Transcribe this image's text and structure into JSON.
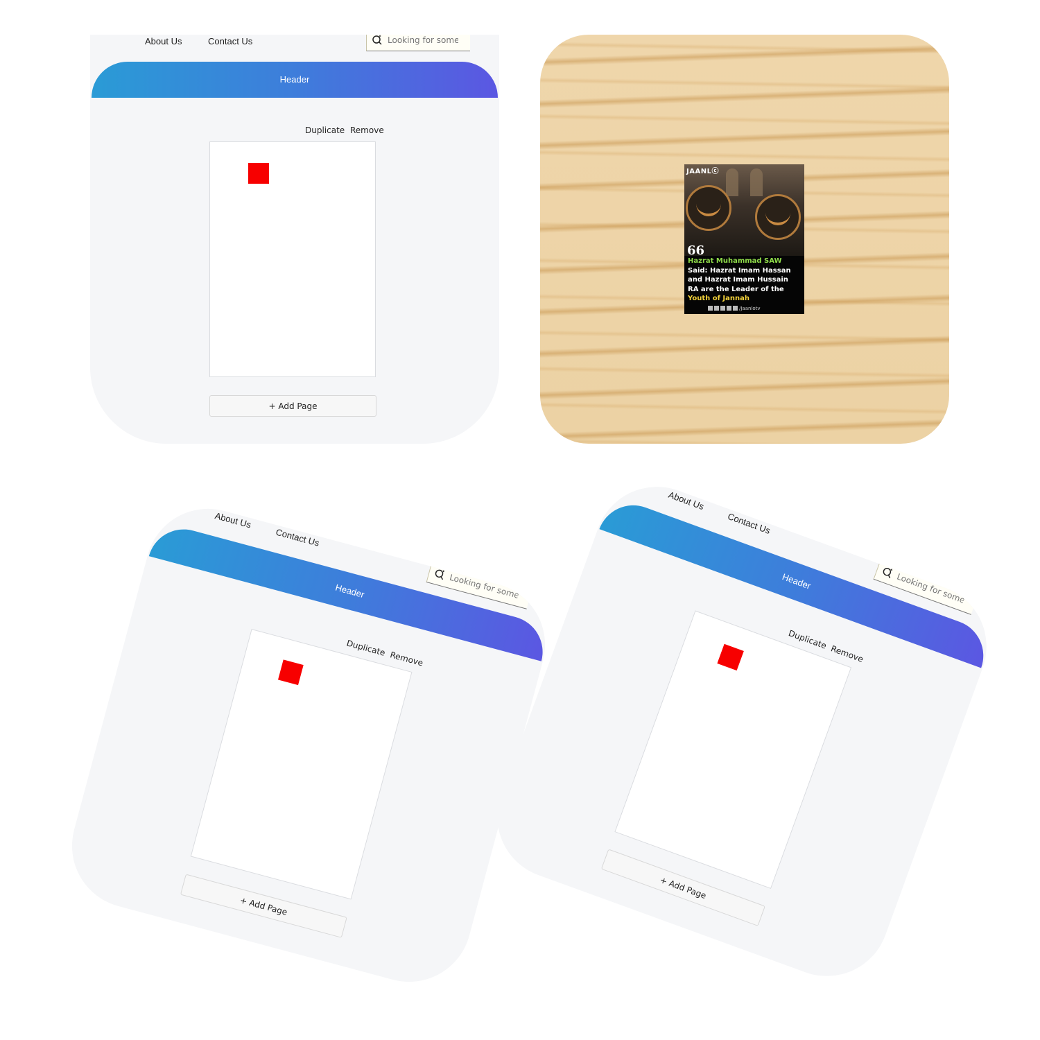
{
  "editor": {
    "nav": {
      "about": "About Us",
      "contact": "Contact Us"
    },
    "search": {
      "placeholder": "Looking for some"
    },
    "header": {
      "label": "Header"
    },
    "page_actions": {
      "duplicate": "Duplicate",
      "remove": "Remove"
    },
    "add_page": "+ Add Page",
    "colors": {
      "gradient_start": "#2a9bd6",
      "gradient_end": "#5b57e2",
      "red_box": "#f70000"
    }
  },
  "poster": {
    "brand": "JAANLⓒ",
    "quote_mark": "66",
    "line1": "Hazrat Muhammad SAW",
    "line2": "Said: Hazrat Imam Hassan",
    "line3": "and Hazrat Imam Hussain",
    "line4": "RA are the Leader of the",
    "line5": "Youth of Jannah",
    "handle": "/Jaanlotv"
  }
}
